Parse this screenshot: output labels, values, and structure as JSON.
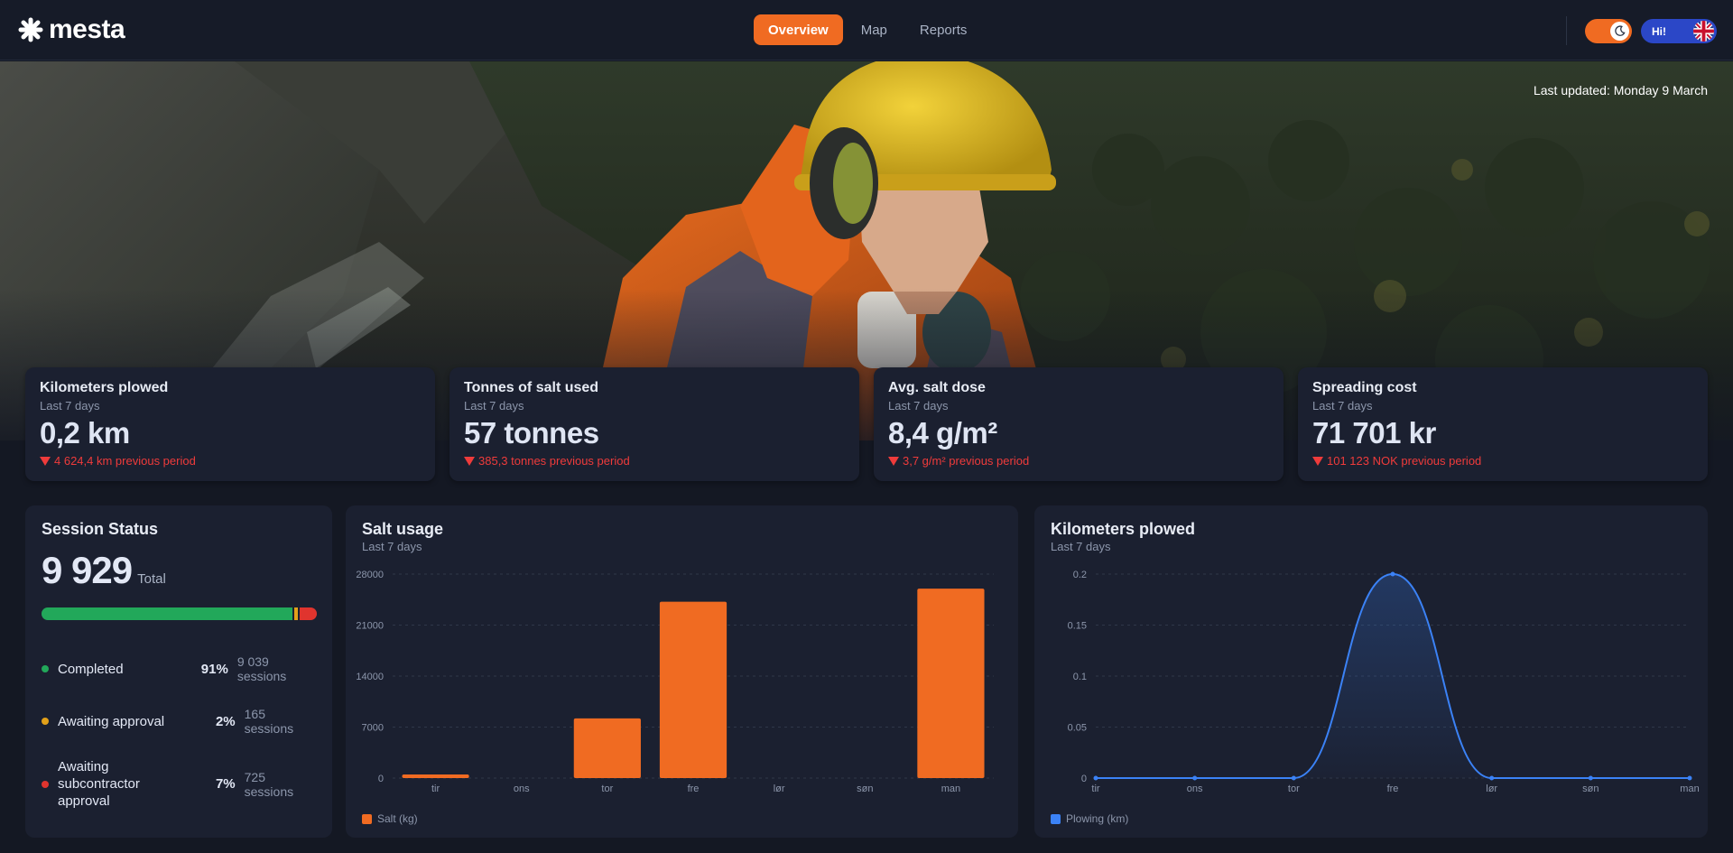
{
  "app": {
    "logo_text": "mesta"
  },
  "nav": {
    "tabs": [
      {
        "label": "Overview",
        "active": true
      },
      {
        "label": "Map",
        "active": false
      },
      {
        "label": "Reports",
        "active": false
      }
    ]
  },
  "header": {
    "theme_icon": "moon-icon",
    "language_label": "Hi!",
    "language_flag": "uk-flag-icon"
  },
  "hero": {
    "last_updated": "Last updated: Monday 9 March"
  },
  "kpis": [
    {
      "title": "Kilometers plowed",
      "period": "Last 7 days",
      "value": "0,2 km",
      "delta": "4 624,4 km previous period",
      "trend": "down"
    },
    {
      "title": "Tonnes of salt used",
      "period": "Last 7 days",
      "value": "57 tonnes",
      "delta": "385,3 tonnes previous period",
      "trend": "down"
    },
    {
      "title": "Avg. salt dose",
      "period": "Last 7 days",
      "value": "8,4 g/m²",
      "delta": "3,7 g/m² previous period",
      "trend": "down"
    },
    {
      "title": "Spreading cost",
      "period": "Last 7 days",
      "value": "71 701 kr",
      "delta": "101 123 NOK previous period",
      "trend": "down"
    }
  ],
  "session_status": {
    "title": "Session Status",
    "total": "9 929",
    "total_label": "Total",
    "rows": [
      {
        "label": "Completed",
        "percent": "91%",
        "count": "9 039 sessions",
        "share": 0.91,
        "color": "#22a85a"
      },
      {
        "label": "Awaiting approval",
        "percent": "2%",
        "count": "165 sessions",
        "share": 0.02,
        "color": "#e2a019"
      },
      {
        "label": "Awaiting subcontractor approval",
        "percent": "7%",
        "count": "725 sessions",
        "share": 0.07,
        "color": "#e0342e"
      }
    ]
  },
  "salt_panel": {
    "title": "Salt usage",
    "subtitle": "Last 7 days"
  },
  "km_panel": {
    "title": "Kilometers plowed",
    "subtitle": "Last 7 days"
  },
  "chart_data": [
    {
      "type": "bar",
      "title": "Salt usage",
      "subtitle": "Last 7 days",
      "categories": [
        "tir",
        "ons",
        "tor",
        "fre",
        "lør",
        "søn",
        "man"
      ],
      "series": [
        {
          "name": "Salt (kg)",
          "values": [
            500,
            0,
            8200,
            24200,
            0,
            0,
            26000
          ],
          "color": "#f06b22"
        }
      ],
      "yticks": [
        "0",
        "7000",
        "14000",
        "21000",
        "28000"
      ],
      "ylim": [
        0,
        28000
      ],
      "grid": true,
      "legend": "bottom-left"
    },
    {
      "type": "area",
      "title": "Kilometers plowed",
      "subtitle": "Last 7 days",
      "categories": [
        "tir",
        "ons",
        "tor",
        "fre",
        "lør",
        "søn",
        "man"
      ],
      "series": [
        {
          "name": "Plowing (km)",
          "values": [
            0,
            0,
            0,
            0.2,
            0,
            0,
            0
          ],
          "color": "#3b82f6"
        }
      ],
      "yticks": [
        "0",
        "0.05",
        "0.1",
        "0.15",
        "0.2"
      ],
      "ylim": [
        0,
        0.2
      ],
      "grid": true,
      "legend": "bottom-left"
    }
  ]
}
